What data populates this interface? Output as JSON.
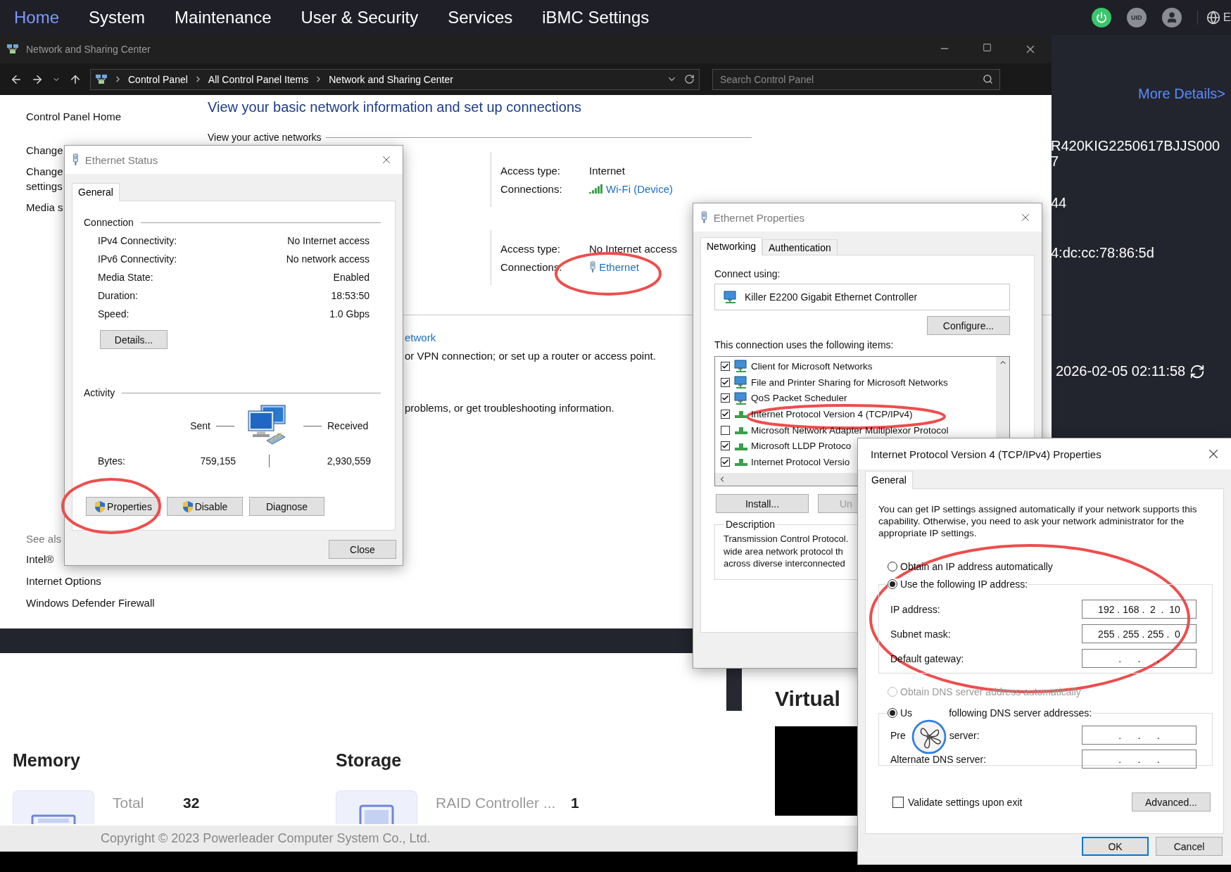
{
  "bmc": {
    "nav": [
      {
        "label": "Home",
        "selected": true
      },
      {
        "label": "System",
        "selected": false
      },
      {
        "label": "Maintenance",
        "selected": false
      },
      {
        "label": "User & Security",
        "selected": false
      },
      {
        "label": "Services",
        "selected": false
      },
      {
        "label": "iBMC Settings",
        "selected": false
      }
    ],
    "uid_label": "UID",
    "language": "E",
    "details_link": "More Details>",
    "info_lines": [
      "R420KIG2250617BJJS000",
      "7",
      "44",
      "4:dc:cc:78:86:5d"
    ],
    "datetime": "2026-02-05 02:11:58",
    "sections": [
      {
        "title": "Memory",
        "label": "Total",
        "value": "32",
        "kind": "memory"
      },
      {
        "title": "Storage",
        "label": "RAID Controller ...",
        "value": "1",
        "kind": "storage"
      }
    ],
    "virtual_title": "Virtual",
    "copyright": "Copyright © 2023 Powerleader Computer System Co., Ltd."
  },
  "network_center": {
    "title": "Network and Sharing Center",
    "breadcrumb": [
      "Control Panel",
      "All Control Panel Items",
      "Network and Sharing Center"
    ],
    "search": {
      "placeholder": "Search Control Panel"
    },
    "sidebar": {
      "items": [
        [
          "Control Panel Home"
        ],
        [
          "Change"
        ],
        [
          "Change",
          "settings"
        ],
        [
          "Media s"
        ]
      ],
      "see_also_title": "See als",
      "see_also": [
        "Intel®",
        "Internet Options",
        "Windows Defender Firewall"
      ]
    },
    "heading": "View your basic network information and set up connections",
    "active_networks_label": "View your active networks",
    "networks": [
      {
        "rows": [
          {
            "label": "Access type:",
            "value": "Internet",
            "kind": "text"
          },
          {
            "label": "Connections:",
            "value": "Wi-Fi (Device)",
            "kind": "wifi"
          }
        ]
      },
      {
        "rows": [
          {
            "label": "Access type:",
            "value": "No Internet access",
            "kind": "text"
          },
          {
            "label": "Connections:",
            "value": "Ethernet",
            "kind": "ethernet"
          }
        ]
      }
    ],
    "lower_lines": [
      {
        "text": "etwork",
        "kind": "link"
      },
      {
        "text": "or VPN connection; or set up a router or access point.",
        "kind": "text"
      },
      {
        "text": "problems, or get troubleshooting information.",
        "kind": "text"
      }
    ]
  },
  "ethernet_status": {
    "title": "Ethernet Status",
    "tabs": [
      {
        "label": "General",
        "selected": true
      }
    ],
    "connection_title": "Connection",
    "rows": [
      {
        "label": "IPv4 Connectivity:",
        "value": "No Internet access"
      },
      {
        "label": "IPv6 Connectivity:",
        "value": "No network access"
      },
      {
        "label": "Media State:",
        "value": "Enabled"
      },
      {
        "label": "Duration:",
        "value": "18:53:50"
      },
      {
        "label": "Speed:",
        "value": "1.0 Gbps"
      }
    ],
    "details_button": "Details...",
    "activity_title": "Activity",
    "sent_label": "Sent",
    "received_label": "Received",
    "bytes_label": "Bytes:",
    "bytes_sent": "759,155",
    "bytes_received": "2,930,559",
    "buttons": [
      {
        "label": "Properties",
        "shield": true
      },
      {
        "label": "Disable",
        "shield": true
      },
      {
        "label": "Diagnose",
        "shield": false
      }
    ],
    "close_button": "Close"
  },
  "ethernet_properties": {
    "title": "Ethernet Properties",
    "tabs": [
      {
        "label": "Networking",
        "selected": true
      },
      {
        "label": "Authentication",
        "selected": false
      }
    ],
    "connect_using_label": "Connect using:",
    "adapter": "Killer E2200 Gigabit Ethernet Controller",
    "configure_button": "Configure...",
    "items_label": "This connection uses the following items:",
    "items": [
      {
        "label": "Client for Microsoft Networks",
        "checked": true,
        "kind": "client"
      },
      {
        "label": "File and Printer Sharing for Microsoft Networks",
        "checked": true,
        "kind": "client"
      },
      {
        "label": "QoS Packet Scheduler",
        "checked": true,
        "kind": "client"
      },
      {
        "label": "Internet Protocol Version 4 (TCP/IPv4)",
        "checked": true,
        "kind": "protocol"
      },
      {
        "label": "Microsoft Network Adapter Multiplexor Protocol",
        "checked": false,
        "kind": "protocol"
      },
      {
        "label": "Microsoft LLDP Protoco",
        "checked": true,
        "kind": "protocol"
      },
      {
        "label": "Internet Protocol Versio",
        "checked": true,
        "kind": "protocol"
      }
    ],
    "buttons": [
      "Install...",
      "Un"
    ],
    "description_title": "Description",
    "description_lines": [
      "Transmission Control Protocol.",
      "wide area network protocol th",
      "across diverse interconnected"
    ]
  },
  "ipv4_properties": {
    "title": "Internet Protocol Version 4 (TCP/IPv4) Properties",
    "tabs": [
      {
        "label": "General",
        "selected": true
      }
    ],
    "intro": "You can get IP settings assigned automatically if your network supports this capability. Otherwise, you need to ask your network administrator for the appropriate IP settings.",
    "ip_mode": [
      {
        "label": "Obtain an IP address automatically",
        "selected": false,
        "disabled": false
      },
      {
        "label": "Use the following IP address:",
        "selected": true,
        "disabled": false
      }
    ],
    "ip_fields": [
      {
        "label": "IP address:",
        "value": "192 . 168 .  2  .  10"
      },
      {
        "label": "Subnet mask:",
        "value": "255 . 255 . 255 .  0"
      },
      {
        "label": "Default gateway:",
        "value": ".      .      ."
      }
    ],
    "dns_mode": [
      {
        "label_parts": [
          "Obtain DNS server address automatically"
        ],
        "selected": false,
        "disabled": true
      },
      {
        "label_parts": [
          "Us",
          "following DNS server addresses:"
        ],
        "selected": true,
        "disabled": false
      }
    ],
    "dns_fields": [
      {
        "label_parts": [
          "Pre",
          "server:"
        ],
        "value": ".      .      ."
      },
      {
        "label_parts": [
          "Alternate DNS server:"
        ],
        "value": ".      .      ."
      }
    ],
    "validate": {
      "label": "Validate settings upon exit",
      "checked": false
    },
    "advanced_button": "Advanced...",
    "buttons": [
      {
        "label": "OK",
        "default": true
      },
      {
        "label": "Cancel",
        "default": false
      }
    ]
  }
}
